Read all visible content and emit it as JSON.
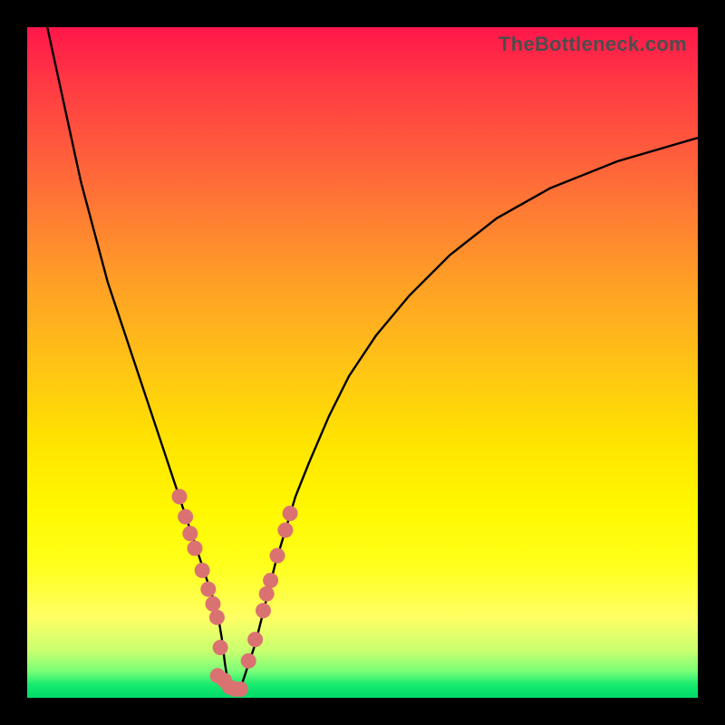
{
  "branding": "TheBottleneck.com",
  "chart_data": {
    "type": "line",
    "title": "",
    "xlabel": "",
    "ylabel": "",
    "xlim": [
      0,
      100
    ],
    "ylim": [
      0,
      100
    ],
    "series": [
      {
        "name": "left-curve",
        "x": [
          3,
          8,
          12,
          15,
          18,
          20,
          22,
          23.5,
          25,
          26,
          27,
          28,
          28.5,
          29,
          29.5,
          30
        ],
        "values": [
          100,
          77,
          62,
          53,
          44,
          38,
          32,
          27.5,
          23,
          20,
          17,
          14,
          12,
          9,
          5,
          2
        ]
      },
      {
        "name": "right-curve",
        "x": [
          32,
          33,
          34,
          35,
          36,
          37,
          38.5,
          40,
          42,
          45,
          48,
          52,
          57,
          63,
          70,
          78,
          88,
          100
        ],
        "values": [
          2,
          5,
          8,
          12,
          16,
          20,
          25,
          30,
          35,
          42,
          48,
          54,
          60,
          66,
          71.5,
          76,
          80,
          83.5
        ]
      }
    ],
    "beads_left": [
      {
        "x": 22.7,
        "y": 30
      },
      {
        "x": 23.6,
        "y": 27
      },
      {
        "x": 24.3,
        "y": 24.5
      },
      {
        "x": 25.0,
        "y": 22.3
      },
      {
        "x": 26.1,
        "y": 19
      },
      {
        "x": 27.0,
        "y": 16.2
      },
      {
        "x": 27.7,
        "y": 14
      },
      {
        "x": 28.3,
        "y": 12
      },
      {
        "x": 28.8,
        "y": 7.5
      },
      {
        "x": 28.4,
        "y": 3.3
      },
      {
        "x": 29.4,
        "y": 2.6
      },
      {
        "x": 30.2,
        "y": 1.6
      },
      {
        "x": 31.0,
        "y": 1.3
      },
      {
        "x": 31.8,
        "y": 1.3
      }
    ],
    "beads_right": [
      {
        "x": 33.0,
        "y": 5.5
      },
      {
        "x": 34.0,
        "y": 8.7
      },
      {
        "x": 35.2,
        "y": 13
      },
      {
        "x": 35.7,
        "y": 15.5
      },
      {
        "x": 36.3,
        "y": 17.5
      },
      {
        "x": 37.3,
        "y": 21.2
      },
      {
        "x": 38.5,
        "y": 25
      },
      {
        "x": 39.2,
        "y": 27.5
      }
    ]
  }
}
